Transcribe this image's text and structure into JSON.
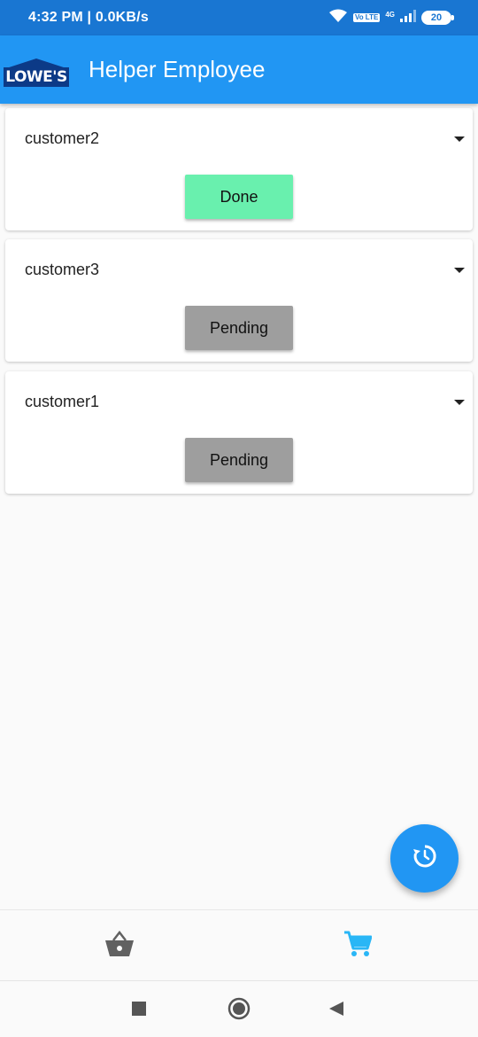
{
  "status_bar": {
    "time_speed": "4:32 PM | 0.0KB/s",
    "volte_label": "Vo LTE",
    "network_label": "4G",
    "battery_level": "20"
  },
  "app_bar": {
    "logo_text": "LOWE'S",
    "title": "Helper Employee",
    "color": "#2196f3"
  },
  "orders": [
    {
      "customer": "customer2",
      "status": "Done",
      "status_color": "#69f0ae"
    },
    {
      "customer": "customer3",
      "status": "Pending",
      "status_color": "#9e9e9e"
    },
    {
      "customer": "customer1",
      "status": "Pending",
      "status_color": "#9e9e9e"
    }
  ],
  "fab": {
    "icon": "refresh-history-icon"
  },
  "bottom_nav": {
    "items": [
      {
        "icon": "basket-icon",
        "active": false
      },
      {
        "icon": "cart-icon",
        "active": true
      }
    ],
    "active_color": "#29b6f6"
  },
  "system_nav": {
    "items": [
      {
        "icon": "recents-square-icon"
      },
      {
        "icon": "home-circle-icon"
      },
      {
        "icon": "back-triangle-icon"
      }
    ]
  }
}
